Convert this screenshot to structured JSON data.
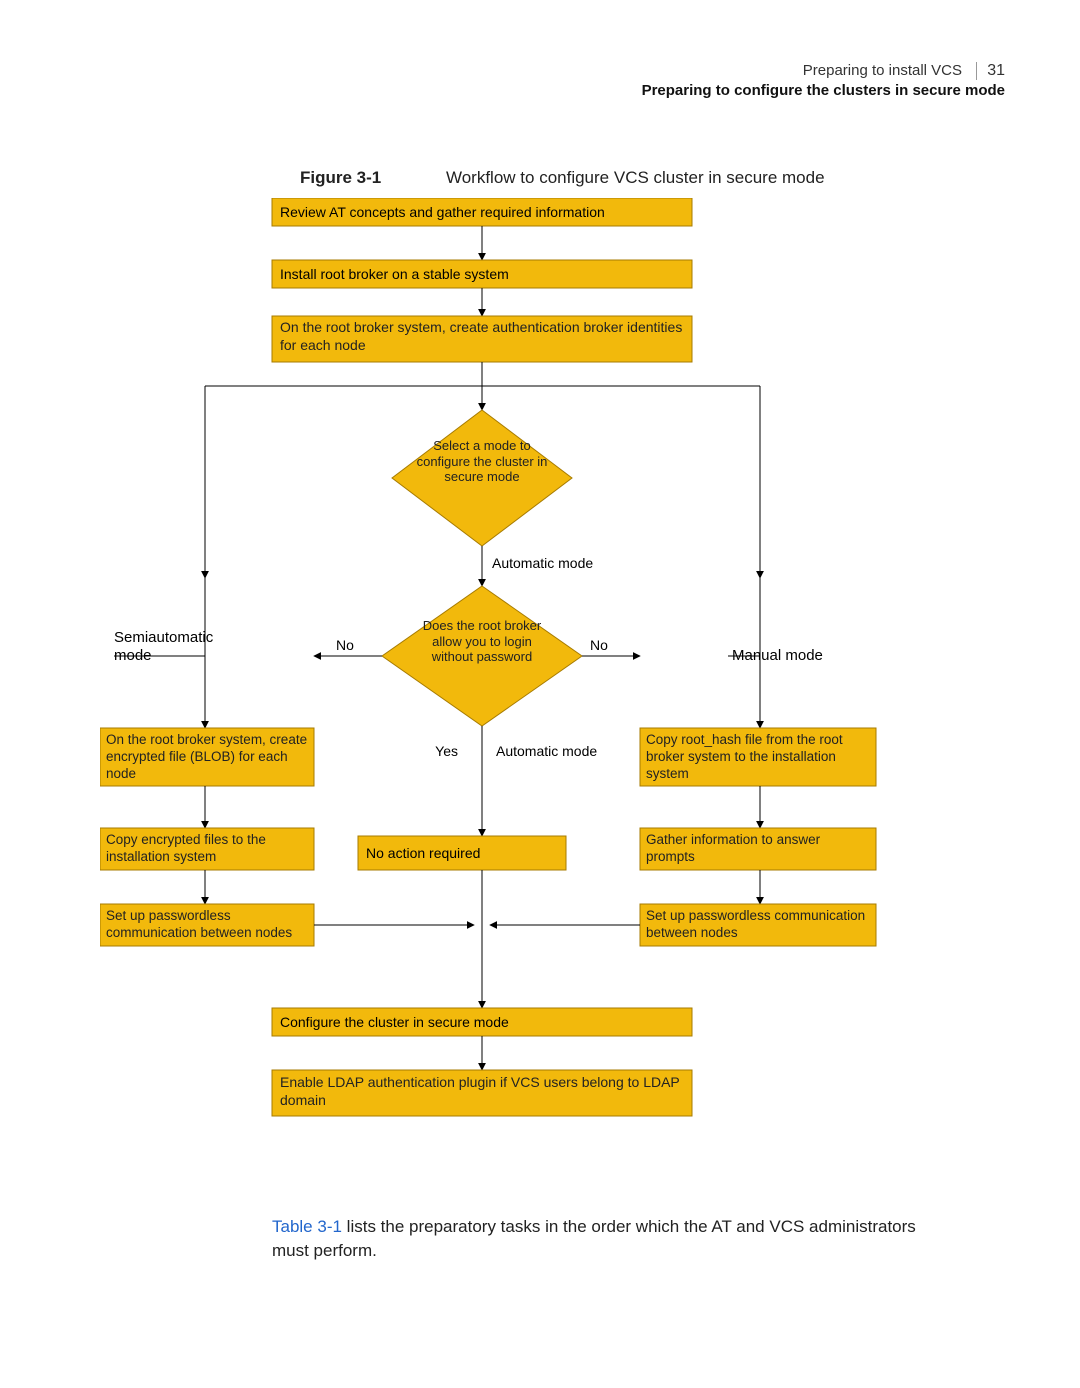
{
  "header": {
    "crumb1": "Preparing to install VCS",
    "crumb2": "Preparing to configure the clusters in secure mode",
    "page_number": "31"
  },
  "figure": {
    "label": "Figure 3-1",
    "caption": "Workflow to configure VCS cluster in secure mode"
  },
  "boxes": {
    "review": "Review AT concepts and gather required information",
    "install_root": "Install root broker on a stable system",
    "create_identities": "On the root broker system, create authentication broker identities for each node",
    "select_mode": "Select a mode to configure the cluster in secure mode",
    "does_root": "Does the root broker allow you to login without password",
    "no_action": "No action required",
    "blob": "On the root broker system, create encrypted file (BLOB) for each node",
    "copy_blob": "Copy encrypted files to the installation system",
    "pwless_left": "Set up passwordless communication between nodes",
    "copy_hash": "Copy root_hash file from the root broker system to the installation system",
    "gather": "Gather information to answer prompts",
    "pwless_right": "Set up passwordless communication between nodes",
    "config_cluster": "Configure the cluster in secure mode",
    "ldap": "Enable LDAP authentication plugin if VCS users belong to LDAP domain"
  },
  "edge_labels": {
    "auto_mode_top": "Automatic mode",
    "no_left": "No",
    "no_right": "No",
    "yes": "Yes",
    "auto_mode_mid": "Automatic mode",
    "semi": "Semiautomatic mode",
    "manual": "Manual mode"
  },
  "body_text": {
    "table_link": "Table 3-1",
    "rest": " lists the preparatory tasks in the order which the AT and VCS administrators must perform."
  },
  "colors": {
    "gold": "#f2b90c",
    "gold_border": "#a77b00",
    "text": "#222222",
    "link": "#2266cc"
  },
  "chart_data": {
    "type": "flowchart",
    "nodes": [
      {
        "id": "review",
        "kind": "process",
        "row": 0
      },
      {
        "id": "install_root",
        "kind": "process",
        "row": 1
      },
      {
        "id": "create_identities",
        "kind": "process",
        "row": 2
      },
      {
        "id": "select_mode",
        "kind": "decision",
        "row": 3
      },
      {
        "id": "does_root",
        "kind": "decision",
        "row": 4
      },
      {
        "id": "blob",
        "kind": "process",
        "branch": "semiauto",
        "row": 5
      },
      {
        "id": "copy_blob",
        "kind": "process",
        "branch": "semiauto",
        "row": 6
      },
      {
        "id": "pwless_left",
        "kind": "process",
        "branch": "semiauto",
        "row": 7
      },
      {
        "id": "no_action",
        "kind": "process",
        "branch": "auto",
        "row": 6
      },
      {
        "id": "copy_hash",
        "kind": "process",
        "branch": "manual",
        "row": 5
      },
      {
        "id": "gather",
        "kind": "process",
        "branch": "manual",
        "row": 6
      },
      {
        "id": "pwless_right",
        "kind": "process",
        "branch": "manual",
        "row": 7
      },
      {
        "id": "config_cluster",
        "kind": "process",
        "row": 8
      },
      {
        "id": "ldap",
        "kind": "process",
        "row": 9
      }
    ],
    "edges": [
      {
        "from": "review",
        "to": "install_root"
      },
      {
        "from": "install_root",
        "to": "create_identities"
      },
      {
        "from": "create_identities",
        "to": "select_mode"
      },
      {
        "from": "select_mode",
        "to": "does_root",
        "label": "Automatic mode"
      },
      {
        "from": "select_mode",
        "to": "blob",
        "branch_label": "Semiautomatic mode"
      },
      {
        "from": "select_mode",
        "to": "copy_hash",
        "branch_label": "Manual mode"
      },
      {
        "from": "does_root",
        "to": "blob",
        "label": "No"
      },
      {
        "from": "does_root",
        "to": "copy_hash",
        "label": "No"
      },
      {
        "from": "does_root",
        "to": "no_action",
        "label": "Yes / Automatic mode"
      },
      {
        "from": "blob",
        "to": "copy_blob"
      },
      {
        "from": "copy_blob",
        "to": "pwless_left"
      },
      {
        "from": "copy_hash",
        "to": "gather"
      },
      {
        "from": "gather",
        "to": "pwless_right"
      },
      {
        "from": "pwless_left",
        "to": "config_cluster"
      },
      {
        "from": "pwless_right",
        "to": "config_cluster"
      },
      {
        "from": "no_action",
        "to": "config_cluster"
      },
      {
        "from": "config_cluster",
        "to": "ldap"
      }
    ]
  }
}
